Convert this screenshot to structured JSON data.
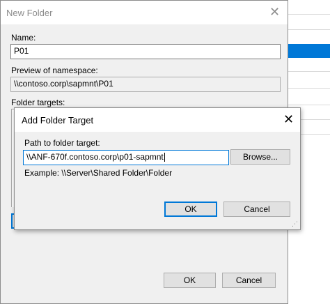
{
  "new_folder_dialog": {
    "title": "New Folder",
    "close_glyph": "✕",
    "name_label": "Name:",
    "name_value": "P01",
    "preview_label": "Preview of namespace:",
    "preview_value": "\\\\contoso.corp\\sapmnt\\P01",
    "targets_label": "Folder targets:",
    "ok_label": "OK",
    "cancel_label": "Cancel"
  },
  "add_target_dialog": {
    "title": "Add Folder Target",
    "close_glyph": "✕",
    "path_label": "Path to folder target:",
    "path_value": "\\\\ANF-670f.contoso.corp\\p01-sapmnt",
    "browse_label": "Browse...",
    "example_text": "Example: \\\\Server\\Shared Folder\\Folder",
    "ok_label": "OK",
    "cancel_label": "Cancel"
  },
  "colors": {
    "accent": "#0078d7",
    "dialog_bg": "#f0f0f0",
    "button_bg": "#e1e1e1"
  }
}
